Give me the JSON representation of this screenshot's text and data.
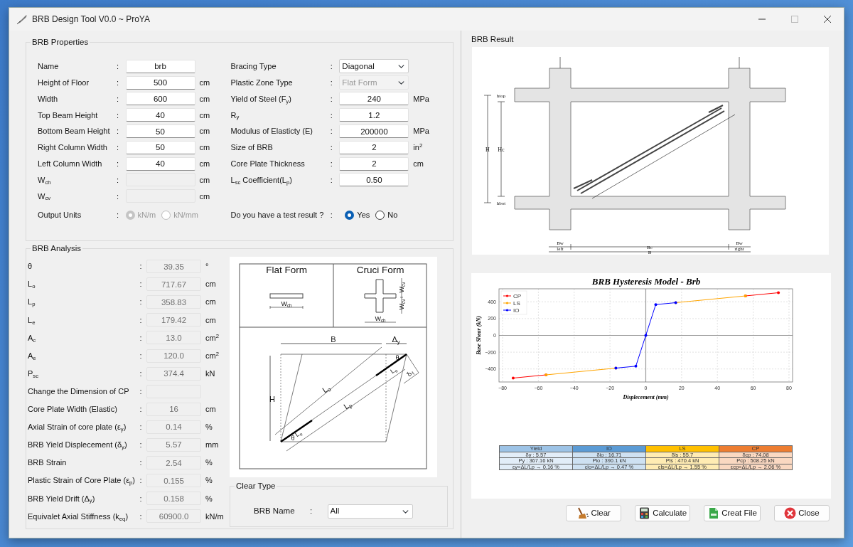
{
  "window": {
    "title": "BRB Design Tool V0.0 ~ ProYA"
  },
  "properties": {
    "title": "BRB Properties",
    "left_fields": [
      {
        "label": "Name",
        "sep": ":",
        "value": "brb",
        "disabled": false
      },
      {
        "label": "Height of Floor",
        "sep": ":",
        "value": "500",
        "unit": "cm",
        "disabled": false
      },
      {
        "label": "Width",
        "sep": ":",
        "value": "600",
        "unit": "cm",
        "disabled": false
      },
      {
        "label": "Top Beam Height",
        "sep": ":",
        "value": "40",
        "unit": "cm",
        "disabled": false
      },
      {
        "label": "Bottom Beam Height",
        "sep": ":",
        "value": "50",
        "unit": "cm",
        "disabled": false
      },
      {
        "label": "Right Column Width",
        "sep": ":",
        "value": "50",
        "unit": "cm",
        "disabled": false
      },
      {
        "label": "Left Column Width",
        "sep": ":",
        "value": "40",
        "unit": "cm",
        "disabled": false
      },
      {
        "label": "W$_{ch}$",
        "sep": ":",
        "unit": "cm",
        "disabled": true
      },
      {
        "label": "W$_{cv}$",
        "sep": ":",
        "unit": "cm",
        "disabled": true
      }
    ],
    "output_units": {
      "label": "Output Units",
      "sep": ":",
      "options": [
        {
          "label": "kN/m",
          "selected": true,
          "disabled": true
        },
        {
          "label": "kN/mm",
          "selected": false,
          "disabled": true
        }
      ]
    },
    "right_fields": [
      {
        "label": "Bracing Type",
        "sep": ":",
        "kind": "select",
        "value": "Diagonal",
        "disabled": false
      },
      {
        "label": "Plastic Zone Type",
        "sep": ":",
        "kind": "select",
        "value": "Flat Form",
        "disabled": true
      },
      {
        "label": "Yield of Steel (F$_{y}$)",
        "sep": ":",
        "kind": "input",
        "value": "240",
        "unit": "MPa",
        "disabled": false
      },
      {
        "label": "R$_{y}$",
        "sep": ":",
        "kind": "input",
        "value": "1.2",
        "disabled": false
      },
      {
        "label": "Modulus of Elasticty (E)",
        "sep": ":",
        "kind": "input",
        "value": "200000",
        "unit": "MPa",
        "disabled": false
      },
      {
        "label": "Size of BRB",
        "sep": ":",
        "kind": "input",
        "value": "2",
        "unit": "in$^{2}$",
        "disabled": false
      },
      {
        "label": "Core Plate Thickness",
        "sep": ":",
        "kind": "input",
        "value": "2",
        "unit": "cm",
        "disabled": false
      },
      {
        "label": "L$_{sc}$ Coefficient(L$_{p}$)",
        "sep": ":",
        "kind": "input",
        "value": "0.50",
        "disabled": false
      }
    ],
    "test_result": {
      "label": "Do you have a test result ?",
      "sep": ":",
      "options": [
        {
          "label": "Yes",
          "selected": true,
          "disabled": false
        },
        {
          "label": "No",
          "selected": false,
          "disabled": false
        }
      ]
    }
  },
  "analysis": {
    "title": "BRB Analysis",
    "rows": [
      {
        "label": "θ",
        "sep": ":",
        "value": "39.35",
        "unit": "°",
        "disabled": true
      },
      {
        "label": "L$_{o}$",
        "sep": ":",
        "value": "717.67",
        "unit": "cm",
        "disabled": true
      },
      {
        "label": "L$_{p}$",
        "sep": ":",
        "value": "358.83",
        "unit": "cm",
        "disabled": true
      },
      {
        "label": "L$_{e}$",
        "sep": ":",
        "value": "179.42",
        "unit": "cm",
        "disabled": true
      },
      {
        "label": "A$_{c}$",
        "sep": ":",
        "value": "13.0",
        "unit": "cm$^{2}$",
        "disabled": true
      },
      {
        "label": "A$_{e}$",
        "sep": ":",
        "value": "120.0",
        "unit": "cm$^{2}$",
        "disabled": true
      },
      {
        "label": "P$_{sc}$",
        "sep": ":",
        "value": "374.4",
        "unit": "kN",
        "disabled": true
      },
      {
        "label": "Change the Dimension of CP",
        "sep": ":",
        "disabled": true
      },
      {
        "label": "Core Plate Width (Elastic)",
        "sep": ":",
        "value": "16",
        "unit": "cm",
        "disabled": true
      },
      {
        "label": "Axial Strain of core plate (ε$_{y}$)",
        "sep": ":",
        "value": "0.14",
        "unit": "%",
        "disabled": true
      },
      {
        "label": "BRB Yield Displecement (δ$_{y}$)",
        "sep": ":",
        "value": "5.57",
        "unit": "mm",
        "disabled": true
      },
      {
        "label": "BRB Strain",
        "sep": ":",
        "value": "2.54",
        "unit": "%",
        "disabled": true
      },
      {
        "label": "Plastic Strain of Core Plate (ε$_{p}$)",
        "sep": ":",
        "value": "0.155",
        "unit": "%",
        "disabled": true
      },
      {
        "label": "BRB Yield Drift (Δ$_{y}$)",
        "sep": ":",
        "value": "0.158",
        "unit": "%",
        "disabled": true
      },
      {
        "label": "Equivalet Axial Stiffness (k$_{eq}$)",
        "sep": ":",
        "value": "60900.0",
        "unit": "kN/m",
        "disabled": true
      }
    ],
    "diagram_labels": [
      "Flat Form",
      "Cruci Form",
      "W$_{ch}$",
      "W$_{cv}$",
      "W$_{cv}$",
      "W$_{ch}$",
      "B",
      "Δ$_{y}$",
      "H",
      "L$_{o}$",
      "L$_{p}$",
      "L$_{e}$",
      "L$_{e}$",
      "θ",
      "θ",
      "δ$_{y}$"
    ],
    "clear_type": {
      "title": "Clear Type",
      "label": "BRB Name",
      "sep": ":",
      "value": "All"
    }
  },
  "result": {
    "title": "BRB Result",
    "drawing_labels": [
      "htop",
      "H",
      "Hc",
      "hbot",
      "Bw",
      "left",
      "Bc",
      "B",
      "Bw",
      "right"
    ],
    "chart": {
      "chart_data": {
        "type": "line",
        "title": "BRB Hysteresis Model - Brb",
        "xlabel": "Displecement (mm)",
        "ylabel": "Base Shear (kN)",
        "x": [
          -74.08,
          -55.7,
          -16.71,
          -5.57,
          0,
          5.57,
          16.71,
          55.7,
          74.08
        ],
        "series": [
          {
            "name": "CP",
            "color": "#ff0000",
            "values": [
              -508.25,
              -470.4,
              null,
              null,
              null,
              null,
              null,
              470.4,
              508.25
            ]
          },
          {
            "name": "LS",
            "color": "#ffa500",
            "values": [
              null,
              -470.4,
              -390.1,
              null,
              null,
              null,
              390.1,
              470.4,
              null
            ]
          },
          {
            "name": "IO",
            "color": "#0000ff",
            "values": [
              null,
              null,
              -390.1,
              -367.16,
              0,
              367.16,
              390.1,
              null,
              null
            ]
          }
        ],
        "grid": true,
        "legend": true,
        "xlim": [
          -82,
          82
        ],
        "ylim": [
          -555,
          555
        ],
        "xticks": [
          {
            "value": -80,
            "label": "−80"
          },
          {
            "value": -60,
            "label": "−60"
          },
          {
            "value": -40,
            "label": "−40"
          },
          {
            "value": -20,
            "label": "−20"
          },
          {
            "value": 0,
            "label": "0"
          },
          {
            "value": 20,
            "label": "20"
          },
          {
            "value": 40,
            "label": "40"
          },
          {
            "value": 60,
            "label": "60"
          },
          {
            "value": 80,
            "label": "80"
          }
        ],
        "yticks": [
          {
            "value": -400,
            "label": "−400"
          },
          {
            "value": -200,
            "label": "−200"
          },
          {
            "value": 0,
            "label": "0"
          },
          {
            "value": 200,
            "label": "200"
          },
          {
            "value": 400,
            "label": "400"
          }
        ]
      }
    },
    "summary_table": {
      "columns": [
        {
          "header": "Yield",
          "color": "#9dc3e6",
          "cells": [
            "δy : 5.57",
            "Py : 367.16 kN",
            "εy=ΔL/Lp → 0.16 %"
          ]
        },
        {
          "header": "IO",
          "color": "#5b9bd5",
          "cells": [
            "δio : 16.71",
            "Pio : 390.1 kN",
            "εio=ΔL/Lp → 0.47 %"
          ]
        },
        {
          "header": "LS",
          "color": "#ffc000",
          "cells": [
            "δls : 55.7",
            "Pls : 470.4 kN",
            "εls=ΔL/Lp → 1.55 %"
          ]
        },
        {
          "header": "CP",
          "color": "#ed7d31",
          "cells": [
            "δcp : 74.08",
            "Pcp : 508.25 kN",
            "εcp=ΔL/Lp → 2.06 %"
          ]
        }
      ]
    },
    "buttons": [
      {
        "label": "Clear",
        "kind": "clear"
      },
      {
        "label": "Calculate",
        "kind": "calculate"
      },
      {
        "label": "Creat File",
        "kind": "file"
      },
      {
        "label": "Close",
        "kind": "close"
      }
    ]
  }
}
